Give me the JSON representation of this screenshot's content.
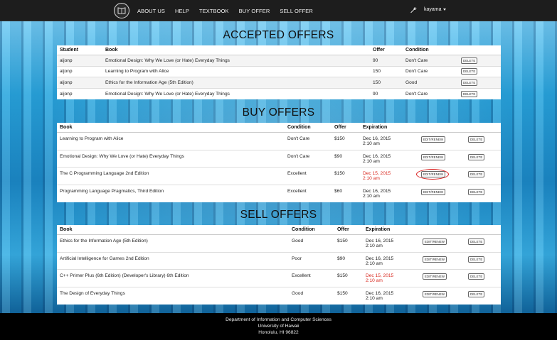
{
  "nav": {
    "items": [
      "ABOUT US",
      "HELP",
      "TEXTBOOK",
      "BUY OFFER",
      "SELL OFFER"
    ],
    "user": "kayama",
    "logo_icon": "book-icon",
    "settings_icon": "wrench-icon"
  },
  "accepted": {
    "title": "ACCEPTED OFFERS",
    "headers": [
      "Student",
      "Book",
      "Offer",
      "Condition",
      ""
    ],
    "rows": [
      {
        "student": "aljonp",
        "book": "Emotional Design: Why We Love (or Hate) Everyday Things",
        "offer": "90",
        "condition": "Don't Care",
        "action": "DELETE"
      },
      {
        "student": "aljonp",
        "book": "Learning to Program with Alice",
        "offer": "150",
        "condition": "Don't Care",
        "action": "DELETE"
      },
      {
        "student": "aljonp",
        "book": "Ethics for the Information Age (5th Edition)",
        "offer": "150",
        "condition": "Good",
        "action": "DELETE"
      },
      {
        "student": "aljonp",
        "book": "Emotional Design: Why We Love (or Hate) Everyday Things",
        "offer": "90",
        "condition": "Don't Care",
        "action": "DELETE"
      }
    ]
  },
  "buy": {
    "title": "BUY OFFERS",
    "headers": [
      "Book",
      "Condition",
      "Offer",
      "Expiration",
      "",
      ""
    ],
    "rows": [
      {
        "book": "Learning to Program with Alice",
        "condition": "Don't Care",
        "offer": "$150",
        "exp_date": "Dec 16, 2015",
        "exp_time": "2:10 am",
        "expired": false,
        "edit": "EDIT/RENEW",
        "delete": "DELETE"
      },
      {
        "book": "Emotional Design: Why We Love (or Hate) Everyday Things",
        "condition": "Don't Care",
        "offer": "$90",
        "exp_date": "Dec 16, 2015",
        "exp_time": "2:10 am",
        "expired": false,
        "edit": "EDIT/RENEW",
        "delete": "DELETE"
      },
      {
        "book": "The C Programming Language 2nd Edition",
        "condition": "Excellent",
        "offer": "$150",
        "exp_date": "Dec 15, 2015",
        "exp_time": "2:10 am",
        "expired": true,
        "edit": "EDIT/RENEW",
        "delete": "DELETE"
      },
      {
        "book": "Programming Language Pragmatics, Third Edition",
        "condition": "Excellent",
        "offer": "$60",
        "exp_date": "Dec 16, 2015",
        "exp_time": "2:10 am",
        "expired": false,
        "edit": "EDIT/RENEW",
        "delete": "DELETE"
      }
    ]
  },
  "sell": {
    "title": "SELL OFFERS",
    "headers": [
      "Book",
      "Condition",
      "Offer",
      "Expiration",
      "",
      ""
    ],
    "rows": [
      {
        "book": "Ethics for the Information Age (5th Edition)",
        "condition": "Good",
        "offer": "$150",
        "exp_date": "Dec 16, 2015",
        "exp_time": "2:10 am",
        "expired": false,
        "edit": "EDIT/RENEW",
        "delete": "DELETE"
      },
      {
        "book": "Artificial Intelligence for Games 2nd Edition",
        "condition": "Poor",
        "offer": "$90",
        "exp_date": "Dec 16, 2015",
        "exp_time": "2:10 am",
        "expired": false,
        "edit": "EDIT/RENEW",
        "delete": "DELETE"
      },
      {
        "book": "C++ Primer Plus (6th Edition) (Developer's Library) 6th Edition",
        "condition": "Excellent",
        "offer": "$150",
        "exp_date": "Dec 15, 2015",
        "exp_time": "2:10 am",
        "expired": true,
        "edit": "EDIT/RENEW",
        "delete": "DELETE"
      },
      {
        "book": "The Design of Everyday Things",
        "condition": "Good",
        "offer": "$150",
        "exp_date": "Dec 16, 2015",
        "exp_time": "2:10 am",
        "expired": false,
        "edit": "EDIT/RENEW",
        "delete": "DELETE"
      }
    ]
  },
  "footer": {
    "line1": "Department of Information and Computer Sciences",
    "line2": "University of Hawaii",
    "line3": "Honolulu, HI 96822"
  },
  "colors": {
    "expired": "#d9261c",
    "highlight_circle": "#d91a1a",
    "nav_bg": "#1d1d1d"
  }
}
